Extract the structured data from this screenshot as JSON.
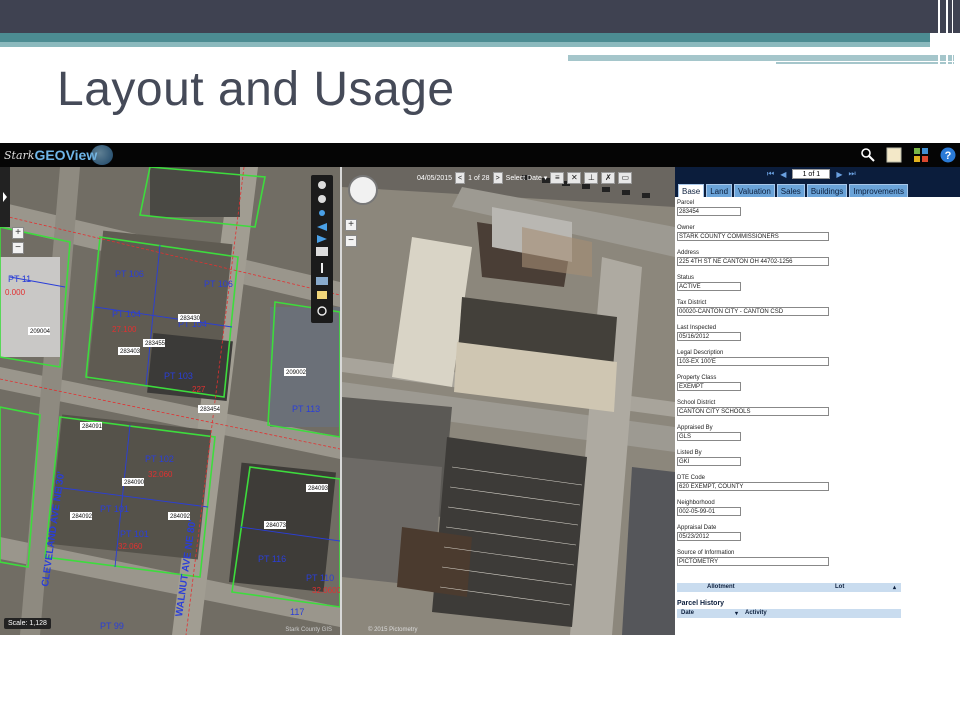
{
  "slide": {
    "title": "Layout and Usage"
  },
  "app": {
    "logo_prefix": "Stark",
    "logo_main": "GEOView",
    "scale_text": "Scale: 1,128",
    "left_credit": "Stark County GIS",
    "right_credit": "© 2015 Pictometry"
  },
  "imagery_toolbar": {
    "date": "04/05/2015",
    "prev": "<",
    "counter": "1 of 28",
    "next": ">",
    "select_date": "Select Date ▾"
  },
  "panel": {
    "pager": {
      "first": "⏮",
      "prev": "◀",
      "page": "1 of 1",
      "next": "▶",
      "last": "⏭"
    },
    "tabs": [
      "Base",
      "Land",
      "Valuation",
      "Sales",
      "Buildings",
      "Improvements"
    ],
    "active_tab": "Base",
    "fields": [
      {
        "label": "Parcel",
        "value": "283454"
      },
      {
        "label": "Owner",
        "value": "STARK COUNTY COMMISSIONERS"
      },
      {
        "label": "Address",
        "value": "225 4TH ST NE CANTON OH 44702-1256"
      },
      {
        "label": "Status",
        "value": "ACTIVE"
      },
      {
        "label": "Tax District",
        "value": "00020-CANTON CITY - CANTON CSD"
      },
      {
        "label": "Last Inspected",
        "value": "05/16/2012"
      },
      {
        "label": "Legal Description",
        "value": "103-EX 100'E"
      },
      {
        "label": "Property Class",
        "value": "EXEMPT"
      },
      {
        "label": "School District",
        "value": "CANTON CITY SCHOOLS"
      },
      {
        "label": "Appraised By",
        "value": "GLS"
      },
      {
        "label": "Listed By",
        "value": "GKI"
      },
      {
        "label": "DTE Code",
        "value": "620 EXEMPT, COUNTY"
      },
      {
        "label": "Neighborhood",
        "value": "002-05-99-01"
      },
      {
        "label": "Appraisal Date",
        "value": "05/23/2012"
      },
      {
        "label": "Source of Information",
        "value": "PICTOMETRY"
      }
    ],
    "allotment_grid": {
      "col1": "Allotment",
      "col2": "Lot"
    },
    "parcel_history_title": "Parcel History",
    "history_grid": {
      "col1": "Date",
      "col2": "Activity"
    }
  },
  "map_labels": {
    "parcels": [
      "PT 106",
      "PT 104",
      "PT 103",
      "PT 102",
      "PT 101",
      "PT 113",
      "PT 116",
      "PT 99",
      "PT 11",
      "117"
    ],
    "streets": [
      "WALNUT AVE NE 80'",
      "CLEVELAND AVE NE 30'"
    ],
    "ids": [
      "283430",
      "283455",
      "283403",
      "284091",
      "284090",
      "284092",
      "284073",
      "209004",
      "283454"
    ]
  },
  "colors": {
    "panel_header": "#0b1d3c",
    "tab_fill": "#6aa3d8",
    "parcel_line": "#3ddc3d",
    "lot_line": "#2a3ed8",
    "label_red": "#e23030"
  }
}
